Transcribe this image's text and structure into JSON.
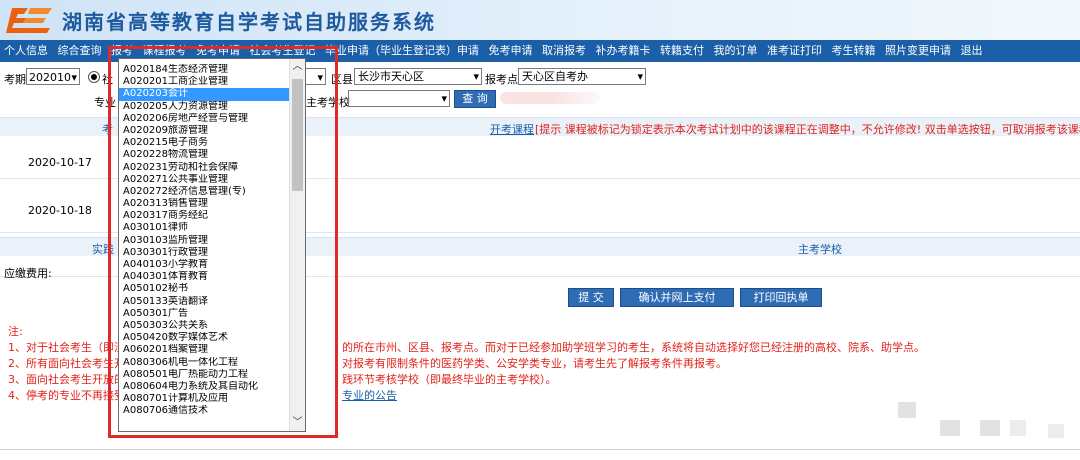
{
  "header": {
    "title": "湖南省高等教育自学考试自助服务系统"
  },
  "nav": [
    "个人信息",
    "综合查询",
    "报考",
    "课程报考",
    "免考申请",
    "社会考生登记",
    "毕业申请（毕业生登记表）申请",
    "免考申请",
    "取消报考",
    "补办考籍卡",
    "转籍支付",
    "我的订单",
    "准考证打印",
    "考生转籍",
    "照片变更申请",
    "退出"
  ],
  "filters": {
    "period_label": "考期",
    "period_value": "202010",
    "radio_label": "社",
    "district_label": "区县",
    "district_value": "长沙市天心区",
    "center_label": "报考点",
    "center_value": "天心区自考办",
    "major_label": "专业",
    "school_label": "主考学校",
    "query_button": "查 询"
  },
  "band1": {
    "left": "考",
    "open_link": "开考课程",
    "hint": "[提示 课程被标记为锁定表示本次考试计划中的该课程正在调整中，不允许修改! 双击单选按钮，可取消报考该课程]"
  },
  "dates": [
    "2020-10-17",
    "2020-10-18"
  ],
  "band2": {
    "left": "实践",
    "right": "主考学校"
  },
  "fee_label": "应缴费用:",
  "buttons": {
    "submit": "提 交",
    "confirm_pay": "确认并网上支付",
    "print_receipt": "打印回执单"
  },
  "notes": {
    "title": "注:",
    "lines": [
      "1、对于社会考生（即没",
      "2、所有面向社会考生开",
      "3、面向社会考生开放的",
      "4、停考的专业不再接受"
    ],
    "right_lines": [
      "的所在市州、区县、报考点。而对于已经参加助学班学习的考生，系统将自动选择好您已经注册的高校、院系、助学点。",
      "对报考有限制条件的医药学类、公安学类专业，请考生先了解报考条件再报考。",
      "践环节考核学校（即最终毕业的主考学校）。",
      "专业的公告"
    ]
  },
  "dropdown": {
    "items": [
      "A020184生态经济管理",
      "A020201工商企业管理",
      "A020203会计",
      "A020205人力资源管理",
      "A020206房地产经营与管理",
      "A020209旅游管理",
      "A020215电子商务",
      "A020228物流管理",
      "A020231劳动和社会保障",
      "A020271公共事业管理",
      "A020272经济信息管理(专)",
      "A020313销售管理",
      "A020317商务经纪",
      "A030101律师",
      "A030103监所管理",
      "A030301行政管理",
      "A040103小学教育",
      "A040301体育教育",
      "A050102秘书",
      "A050133英语翻译",
      "A050301广告",
      "A050303公共关系",
      "A050420数字媒体艺术",
      "A060201档案管理",
      "A080306机电一体化工程",
      "A080501电厂热能动力工程",
      "A080604电力系统及其自动化",
      "A080701计算机及应用",
      "A080706通信技术"
    ],
    "selected_index": 2
  }
}
